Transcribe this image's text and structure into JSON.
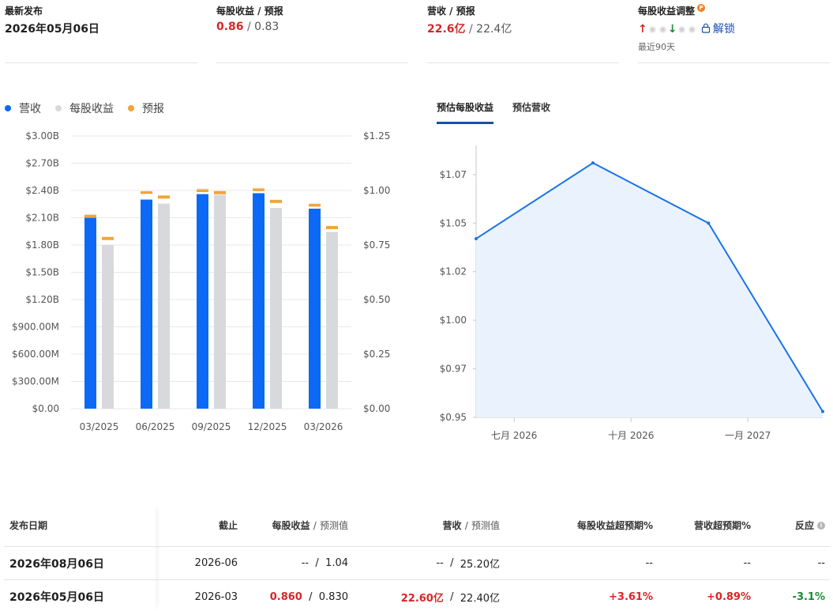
{
  "stats": {
    "latest": {
      "title": "最新发布",
      "value": "2026年05月06日"
    },
    "eps": {
      "title": "每股收益 / 预报",
      "actual": "0.86",
      "sep": "/",
      "forecast": "0.83"
    },
    "revenue": {
      "title": "营收 / 预报",
      "actual": "22.6亿",
      "sep": "/",
      "forecast": "22.4亿"
    },
    "adjust": {
      "title": "每股收益调整",
      "badge": "P",
      "unlock": "解锁",
      "period": "最近90天"
    }
  },
  "legend": {
    "revenue": "营收",
    "eps": "每股收益",
    "forecast": "预报"
  },
  "colors": {
    "revenue": "#0b69f5",
    "eps": "#d7d9dc",
    "forecast": "#f0a53a",
    "line": "#1a73e8",
    "area": "#eaf3fd",
    "up": "#d62728",
    "down": "#1a8a33"
  },
  "tabs": {
    "eps_forecast": "预估每股收益",
    "rev_forecast": "预估营收"
  },
  "chart_data": [
    {
      "type": "bar",
      "categories": [
        "03/2025",
        "06/2025",
        "09/2025",
        "12/2025",
        "03/2026"
      ],
      "left_axis": {
        "ticks": [
          "$0.00",
          "$300.00M",
          "$600.00M",
          "$900.00M",
          "$1.20B",
          "$1.50B",
          "$1.80B",
          "$2.10B",
          "$2.40B",
          "$2.70B",
          "$3.00B"
        ],
        "ylim": [
          0,
          3.0
        ],
        "unit": "B"
      },
      "right_axis": {
        "ticks": [
          "$0.00",
          "$0.25",
          "$0.50",
          "$0.75",
          "$1.00",
          "$1.25"
        ],
        "ylim": [
          0,
          1.25
        ]
      },
      "series": [
        {
          "name": "营收",
          "axis": "left",
          "actual": [
            2.1,
            2.3,
            2.36,
            2.37,
            2.2
          ],
          "forecast": [
            2.12,
            2.38,
            2.4,
            2.41,
            2.24
          ]
        },
        {
          "name": "每股收益",
          "axis": "right",
          "actual": [
            0.75,
            0.94,
            0.98,
            0.92,
            0.81
          ],
          "forecast": [
            0.78,
            0.97,
            0.99,
            0.95,
            0.83
          ]
        }
      ]
    },
    {
      "type": "area",
      "x": [
        "2026-06",
        "2026-09",
        "2026-12",
        "2027-03"
      ],
      "y": [
        1.042,
        1.081,
        1.05,
        0.953
      ],
      "xticks": [
        "七月 2026",
        "十月 2026",
        "一月 2027"
      ],
      "yticks": [
        "$0.95",
        "$0.97",
        "$1.00",
        "$1.02",
        "$1.05",
        "$1.07"
      ],
      "ylim": [
        0.95,
        1.09
      ]
    }
  ],
  "table": {
    "headers": {
      "date": "发布日期",
      "cutoff": "截止",
      "eps": "每股收益",
      "eps_sep": "/",
      "eps_fc": "预测值",
      "rev": "营收",
      "rev_sep": "/",
      "rev_fc": "预测值",
      "eps_surprise": "每股收益超预期%",
      "rev_surprise": "营收超预期%",
      "reaction": "反应"
    },
    "rows": [
      {
        "date": "2026年08月06日",
        "cutoff": "2026-06",
        "eps": "--",
        "sep": "/",
        "eps_fc": "1.04",
        "rev": "--",
        "sep2": "/",
        "rev_fc": "25.20亿",
        "eps_surprise": "--",
        "rev_surprise": "--",
        "reaction": "--"
      },
      {
        "date": "2026年05月06日",
        "cutoff": "2026-03",
        "eps": "0.860",
        "sep": "/",
        "eps_fc": "0.830",
        "rev": "22.60亿",
        "sep2": "/",
        "rev_fc": "22.40亿",
        "eps_surprise": "+3.61%",
        "rev_surprise": "+0.89%",
        "reaction": "-3.1%"
      }
    ]
  }
}
